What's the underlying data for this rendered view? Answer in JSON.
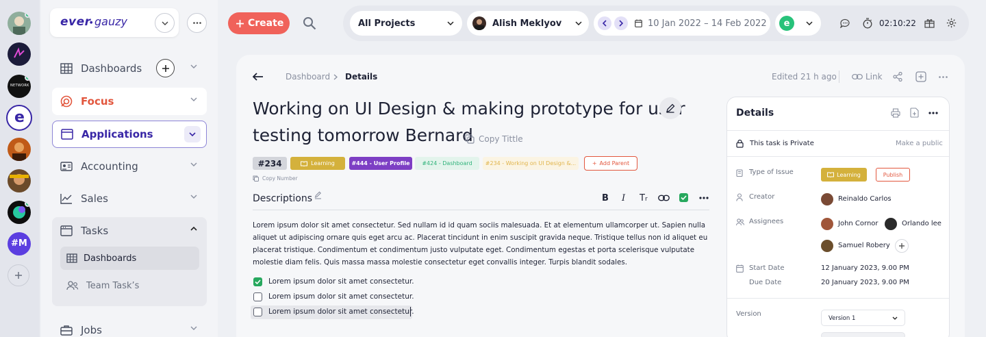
{
  "brand": {
    "logo_main": "ever",
    "logo_sub": "gauzy"
  },
  "workspaces": [
    {
      "name": "workspace-1",
      "color": "#8fae9c"
    },
    {
      "name": "workspace-2",
      "color": "#1c1c3a"
    },
    {
      "name": "workspace-3",
      "color": "#111111",
      "label": "NETWORK"
    },
    {
      "name": "workspace-ever",
      "color": "#ffffff",
      "label": "e"
    },
    {
      "name": "workspace-5",
      "color": "#c05a18"
    },
    {
      "name": "workspace-6",
      "color": "#6b4a2a"
    },
    {
      "name": "workspace-7",
      "color": "#0d0d0d"
    },
    {
      "name": "workspace-m",
      "color": "#5b3ee0",
      "label": "#M"
    }
  ],
  "sidebar": {
    "dashboards": "Dashboards",
    "focus": "Focus",
    "applications": "Applications",
    "accounting": "Accounting",
    "sales": "Sales",
    "tasks": "Tasks",
    "tasks_children": [
      "Dashboards",
      "Team Task’s"
    ],
    "jobs": "Jobs"
  },
  "topbar": {
    "create_label": "Create",
    "project": "All Projects",
    "user": "Alish Meklyov",
    "date_range": "10 Jan 2022 – 14 Feb 2022",
    "timer": "02:10:22"
  },
  "header": {
    "breadcrumb": [
      "Dashboard",
      "Details"
    ],
    "edited": "Edited 21 h ago",
    "link_label": "Link"
  },
  "task": {
    "title_line1": "Working on UI Design & making prototype for user",
    "title_line2": "testing tomorrow Bernard",
    "copy_title": "Copy Tittle",
    "number": "#234",
    "copy_number": "Copy Number",
    "tags": [
      {
        "label": "Learning",
        "bg": "#d4b13c",
        "fg": "#ffffff"
      },
      {
        "label": "#444 - User Profile",
        "bg": "#7d3fc4",
        "fg": "#ffffff"
      },
      {
        "label": "#424 - Dashboard",
        "bg": "#e3f4ec",
        "fg": "#2fb27a"
      },
      {
        "label": "#234 - Working on UI Design &...",
        "bg": "#fbf4e3",
        "fg": "#e0b44b"
      }
    ],
    "add_parent": "Add Parent",
    "descriptions_label": "Descriptions",
    "description": "Lorem ipsum dolor sit amet consectetur. Sed nullam id id quam sociis malesuada. Et at elementum ullamcorper ut. Sapien nulla aliquet ut adipiscing ornare quis eget arcu ac. Placerat tincidunt in enim suscipit gravida neque. Tristique tellus non id aliquet eu placerat tristique. Condimentum et condimentum justo vulputate eget. Condimentum egestas et porta scelerisque vulputate molestie diam felis. Quis massa massa molestie consectetur eget convallis integer. Turpis blandit sodales.",
    "checklist": [
      {
        "text": "Lorem ipsum dolor sit amet consectetur.",
        "checked": true
      },
      {
        "text": "Lorem ipsum dolor sit amet consectetur.",
        "checked": false
      },
      {
        "text": "Lorem ipsum dolor sit amet consectetur.",
        "checked": false
      }
    ]
  },
  "details": {
    "title": "Details",
    "private_text": "This task is Private",
    "make_public": "Make a public",
    "type_label": "Type of Issue",
    "type_value": "Learning",
    "publish": "Publish",
    "creator_label": "Creator",
    "creator": "Reinaldo Carlos",
    "assignees_label": "Assignees",
    "assignees": [
      "John Cornor",
      "Orlando lee",
      "Samuel Robery"
    ],
    "start_label": "Start Date",
    "start_value": "12 January 2023, 9.00 PM",
    "due_label": "Due Date",
    "due_value": "20 January 2023, 9.00 PM",
    "version_label": "Version",
    "version_value": "Version 1"
  },
  "colors": {
    "accent": "#3826a6",
    "create": "#f0625a",
    "purple_border": "#8c84d6"
  }
}
